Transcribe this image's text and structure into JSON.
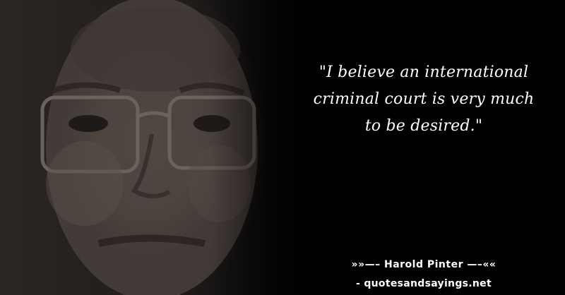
{
  "quote": {
    "text": "\"I believe an international criminal court is very much to be desired.\"",
    "author_line": "»»—– Harold Pinter —–««",
    "source": "- quotesandsayings.net"
  },
  "colors": {
    "background": "#000000",
    "text": "#ffffff"
  }
}
